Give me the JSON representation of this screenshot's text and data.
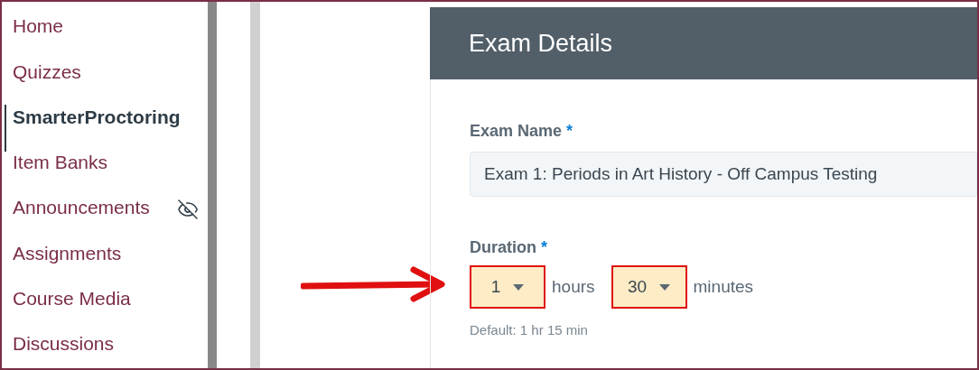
{
  "sidebar": {
    "items": [
      {
        "label": "Home",
        "selected": false,
        "hidden": false
      },
      {
        "label": "Quizzes",
        "selected": false,
        "hidden": false
      },
      {
        "label": "SmarterProctoring",
        "selected": true,
        "hidden": false
      },
      {
        "label": "Item Banks",
        "selected": false,
        "hidden": false
      },
      {
        "label": "Announcements",
        "selected": false,
        "hidden": true
      },
      {
        "label": "Assignments",
        "selected": false,
        "hidden": false
      },
      {
        "label": "Course Media",
        "selected": false,
        "hidden": false
      },
      {
        "label": "Discussions",
        "selected": false,
        "hidden": false
      }
    ]
  },
  "panel": {
    "title": "Exam Details",
    "exam_name": {
      "label": "Exam Name",
      "required_mark": "*",
      "value": "Exam 1: Periods in Art History - Off Campus Testing"
    },
    "duration": {
      "label": "Duration",
      "required_mark": "*",
      "selects": [
        {
          "value": "1",
          "unit": "hours",
          "highlighted": true
        },
        {
          "value": "30",
          "unit": "minutes",
          "highlighted": true
        }
      ],
      "hint": "Default: 1 hr 15 min"
    }
  }
}
